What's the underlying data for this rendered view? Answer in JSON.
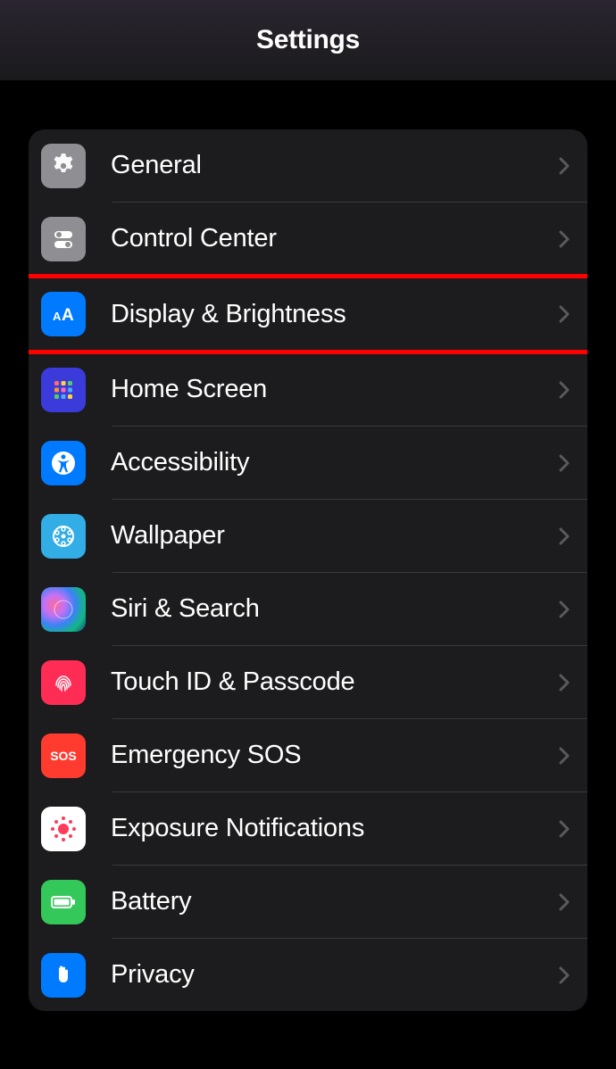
{
  "header": {
    "title": "Settings"
  },
  "rows": [
    {
      "label": "General",
      "iconName": "gear-icon"
    },
    {
      "label": "Control Center",
      "iconName": "switches-icon"
    },
    {
      "label": "Display & Brightness",
      "iconName": "text-size-icon"
    },
    {
      "label": "Home Screen",
      "iconName": "home-screen-icon"
    },
    {
      "label": "Accessibility",
      "iconName": "accessibility-icon"
    },
    {
      "label": "Wallpaper",
      "iconName": "wallpaper-icon"
    },
    {
      "label": "Siri & Search",
      "iconName": "siri-icon"
    },
    {
      "label": "Touch ID & Passcode",
      "iconName": "fingerprint-icon"
    },
    {
      "label": "Emergency SOS",
      "iconName": "sos-icon"
    },
    {
      "label": "Exposure Notifications",
      "iconName": "exposure-icon"
    },
    {
      "label": "Battery",
      "iconName": "battery-icon"
    },
    {
      "label": "Privacy",
      "iconName": "hand-icon"
    }
  ],
  "highlightedIndex": 2
}
